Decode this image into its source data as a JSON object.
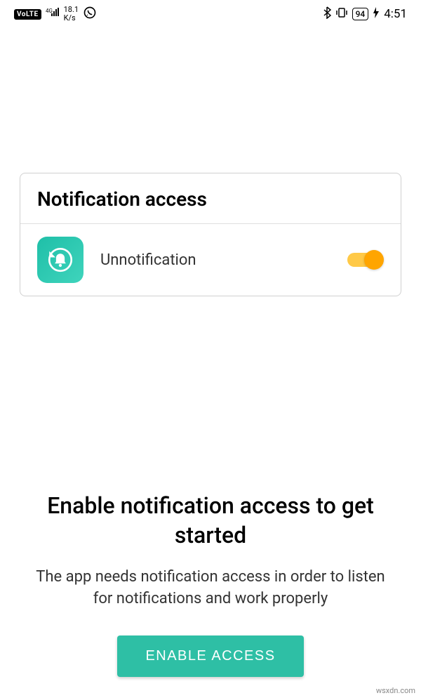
{
  "status_bar": {
    "volte": "VoLTE",
    "network_type": "4G",
    "speed_value": "18.1",
    "speed_unit": "K/s",
    "battery_level": "94",
    "time": "4:51"
  },
  "settings": {
    "header_title": "Notification access",
    "app": {
      "name": "Unnotification",
      "icon_name": "bell-refresh-icon",
      "toggle_on": true
    }
  },
  "prompt": {
    "title": "Enable notification access to get started",
    "description": "The app needs notification access in order to listen for notifications and work properly",
    "button_label": "ENABLE ACCESS"
  },
  "watermark": "wsxdn.com",
  "colors": {
    "accent_teal": "#2ebfa5",
    "toggle_track": "#ffc947",
    "toggle_thumb": "#ffa500"
  }
}
